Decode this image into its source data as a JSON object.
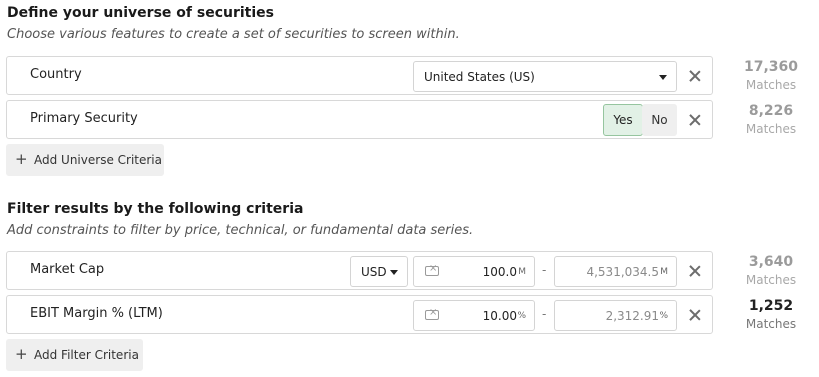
{
  "universe": {
    "title": "Define your universe of securities",
    "subtitle": "Choose various features to create a set of securities to screen within.",
    "add_label": "Add Universe Criteria",
    "add_icon": "plus-icon",
    "rows": [
      {
        "label": "Country",
        "select_value": "United States (US)",
        "matches_count": "17,360",
        "matches_label": "Matches"
      },
      {
        "label": "Primary Security",
        "yes_label": "Yes",
        "no_label": "No",
        "selected": "Yes",
        "matches_count": "8,226",
        "matches_label": "Matches"
      }
    ]
  },
  "filters": {
    "title": "Filter results by the following criteria",
    "subtitle": "Add constraints to filter by price, technical, or fundamental data series.",
    "add_label": "Add Filter Criteria",
    "add_icon": "plus-icon",
    "rows": [
      {
        "label": "Market Cap",
        "currency": "USD",
        "min_value": "100.0",
        "min_unit": "M",
        "separator": "-",
        "max_placeholder": "4,531,034.5",
        "max_unit": "M",
        "matches_count": "3,640",
        "matches_label": "Matches"
      },
      {
        "label": "EBIT Margin % (LTM)",
        "min_value": "10.00",
        "min_unit": "%",
        "separator": "-",
        "max_placeholder": "2,312.91",
        "max_unit": "%",
        "matches_count": "1,252",
        "matches_label": "Matches"
      }
    ]
  },
  "colors": {
    "toggle_selected_bg": "#e2f1e6",
    "toggle_selected_border": "#96c59f",
    "row_border": "#d8d8d8"
  }
}
